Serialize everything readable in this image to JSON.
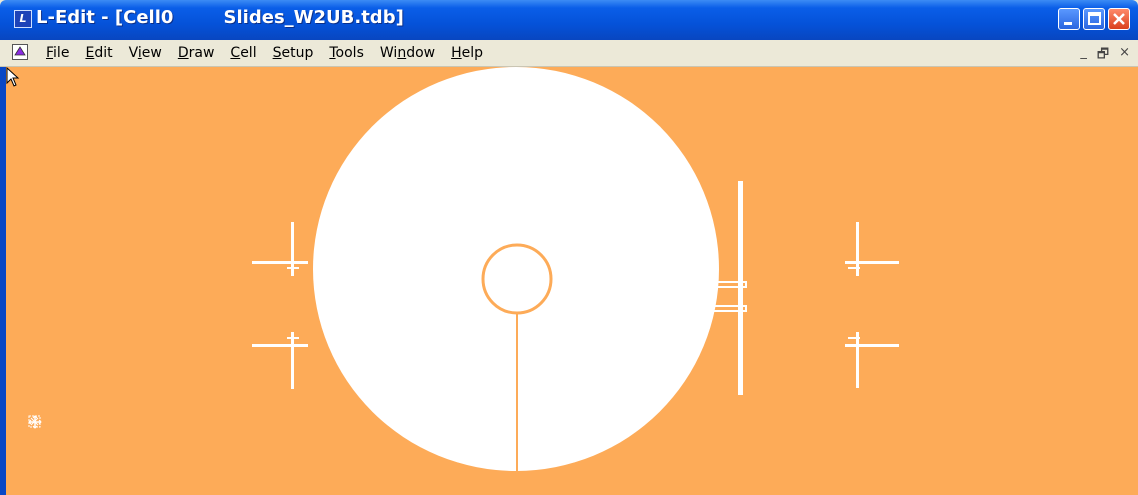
{
  "window": {
    "title": "L-Edit - [Cell0        Slides_W2UB.tdb]",
    "app_icon_glyph": "L"
  },
  "menu": {
    "items": [
      {
        "label": "File",
        "accel": "F"
      },
      {
        "label": "Edit",
        "accel": "E"
      },
      {
        "label": "View",
        "accel": "i"
      },
      {
        "label": "Draw",
        "accel": "D"
      },
      {
        "label": "Cell",
        "accel": "C"
      },
      {
        "label": "Setup",
        "accel": "S"
      },
      {
        "label": "Tools",
        "accel": "T"
      },
      {
        "label": "Window",
        "accel": "n"
      },
      {
        "label": "Help",
        "accel": "H"
      }
    ],
    "mdi_controls": [
      "_",
      "🗗",
      "×"
    ]
  },
  "canvas": {
    "background_color": "#fdab58",
    "shape_color": "#ffffff"
  }
}
